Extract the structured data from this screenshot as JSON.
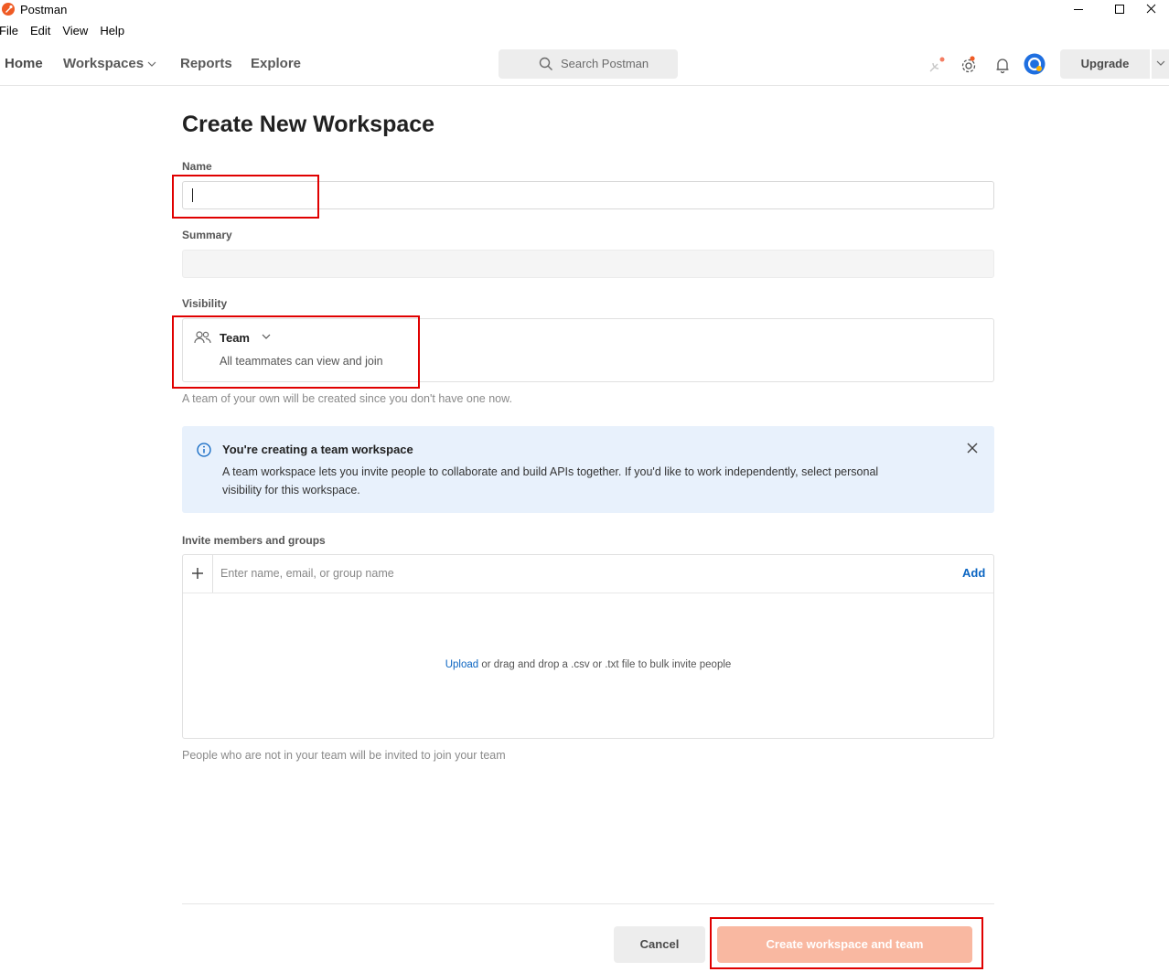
{
  "window": {
    "title": "Postman"
  },
  "menu": [
    "File",
    "Edit",
    "View",
    "Help"
  ],
  "nav": {
    "home": "Home",
    "workspaces": "Workspaces",
    "reports": "Reports",
    "explore": "Explore"
  },
  "search": {
    "placeholder": "Search Postman"
  },
  "header": {
    "upgrade_label": "Upgrade"
  },
  "form": {
    "title": "Create New Workspace",
    "name_label": "Name",
    "name_value": "",
    "summary_label": "Summary",
    "summary_value": "",
    "visibility_label": "Visibility",
    "visibility_value": "Team",
    "visibility_desc": "All teammates can view and join",
    "team_hint": "A team of your own will be created since you don't have one now.",
    "info_title": "You're creating a team workspace",
    "info_text": "A team workspace lets you invite people to collaborate and build APIs together. If you'd like to work independently, select personal visibility for this workspace.",
    "invite_label": "Invite members and groups",
    "invite_placeholder": "Enter name, email, or group name",
    "invite_add": "Add",
    "upload_link": "Upload",
    "upload_text": " or drag and drop a .csv or .txt file to bulk invite people",
    "invite_hint": "People who are not in your team will be invited to join your team",
    "cancel_label": "Cancel",
    "create_label": "Create workspace and team"
  },
  "colors": {
    "brand": "#ef5b25",
    "link": "#0b65c2",
    "info_bg": "#e8f1fc",
    "create_disabled": "#f9b8a1",
    "highlight": "#e00000"
  }
}
